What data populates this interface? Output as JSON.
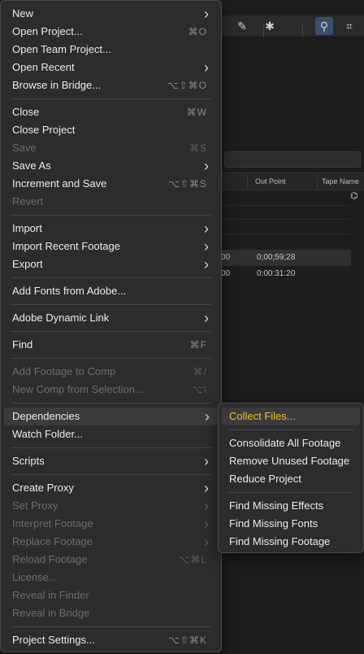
{
  "background": {
    "column_headers": [
      "Out Point",
      "Tape Name"
    ],
    "rows": [
      {
        "left": "00",
        "out_point": "0;00;59;28"
      },
      {
        "left": "00",
        "out_point": "0:00:31:20"
      }
    ]
  },
  "file_menu": {
    "sections": [
      [
        {
          "label": "New",
          "submenu": true,
          "enabled": true
        },
        {
          "label": "Open Project...",
          "shortcut": "⌘O",
          "enabled": true
        },
        {
          "label": "Open Team Project...",
          "enabled": true
        },
        {
          "label": "Open Recent",
          "submenu": true,
          "enabled": true
        },
        {
          "label": "Browse in Bridge...",
          "shortcut": "⌥⇧⌘O",
          "enabled": true
        }
      ],
      [
        {
          "label": "Close",
          "shortcut": "⌘W",
          "enabled": true
        },
        {
          "label": "Close Project",
          "enabled": true
        },
        {
          "label": "Save",
          "shortcut": "⌘S",
          "enabled": false
        },
        {
          "label": "Save As",
          "submenu": true,
          "enabled": true
        },
        {
          "label": "Increment and Save",
          "shortcut": "⌥⇧⌘S",
          "enabled": true
        },
        {
          "label": "Revert",
          "enabled": false
        }
      ],
      [
        {
          "label": "Import",
          "submenu": true,
          "enabled": true
        },
        {
          "label": "Import Recent Footage",
          "submenu": true,
          "enabled": true
        },
        {
          "label": "Export",
          "submenu": true,
          "enabled": true
        }
      ],
      [
        {
          "label": "Add Fonts from Adobe...",
          "enabled": true
        }
      ],
      [
        {
          "label": "Adobe Dynamic Link",
          "submenu": true,
          "enabled": true
        }
      ],
      [
        {
          "label": "Find",
          "shortcut": "⌘F",
          "enabled": true
        }
      ],
      [
        {
          "label": "Add Footage to Comp",
          "shortcut": "⌘/",
          "enabled": false
        },
        {
          "label": "New Comp from Selection...",
          "shortcut": "⌥\\",
          "enabled": false
        }
      ],
      [
        {
          "label": "Dependencies",
          "submenu": true,
          "enabled": true,
          "highlighted": true
        },
        {
          "label": "Watch Folder...",
          "enabled": true
        }
      ],
      [
        {
          "label": "Scripts",
          "submenu": true,
          "enabled": true
        }
      ],
      [
        {
          "label": "Create Proxy",
          "submenu": true,
          "enabled": true
        },
        {
          "label": "Set Proxy",
          "submenu": true,
          "enabled": false
        },
        {
          "label": "Interpret Footage",
          "submenu": true,
          "enabled": false
        },
        {
          "label": "Replace Footage",
          "submenu": true,
          "enabled": false
        },
        {
          "label": "Reload Footage",
          "shortcut": "⌥⌘L",
          "enabled": false
        },
        {
          "label": "License...",
          "enabled": false
        },
        {
          "label": "Reveal in Finder",
          "enabled": false
        },
        {
          "label": "Reveal in Bridge",
          "enabled": false
        }
      ],
      [
        {
          "label": "Project Settings...",
          "shortcut": "⌥⇧⌘K",
          "enabled": true
        }
      ]
    ]
  },
  "dependencies_submenu": {
    "sections": [
      [
        {
          "label": "Collect Files...",
          "enabled": true,
          "highlighted": true
        }
      ],
      [
        {
          "label": "Consolidate All Footage",
          "enabled": true
        },
        {
          "label": "Remove Unused Footage",
          "enabled": true
        },
        {
          "label": "Reduce Project",
          "enabled": true
        }
      ],
      [
        {
          "label": "Find Missing Effects",
          "enabled": true
        },
        {
          "label": "Find Missing Fonts",
          "enabled": true
        },
        {
          "label": "Find Missing Footage",
          "enabled": true
        }
      ]
    ]
  },
  "colors": {
    "highlight_text": "#e7c32a",
    "menu_bg": "#2c2c2e",
    "disabled_text": "#6e6e70"
  }
}
